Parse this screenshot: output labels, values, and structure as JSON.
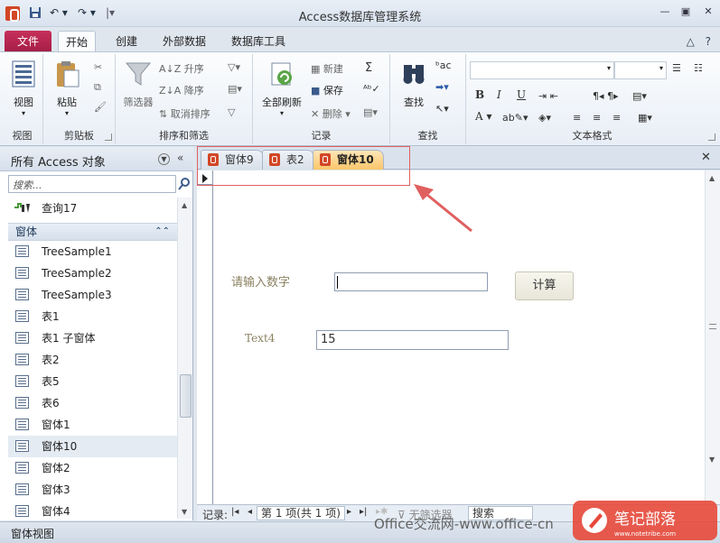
{
  "window": {
    "title": "Access数据库管理系统"
  },
  "ribbon_tabs": {
    "file": "文件",
    "items": [
      "开始",
      "创建",
      "外部数据",
      "数据库工具"
    ]
  },
  "ribbon": {
    "view": {
      "button": "视图",
      "group": "视图"
    },
    "clipboard": {
      "paste": "粘贴",
      "group": "剪贴板"
    },
    "sort_filter": {
      "filter": "筛选器",
      "ascending": "升序",
      "descending": "降序",
      "clear_sort": "取消排序",
      "group": "排序和筛选"
    },
    "records": {
      "refresh_all": "全部刷新",
      "new": "新建",
      "save": "保存",
      "delete": "删除",
      "group": "记录"
    },
    "find": {
      "find": "查找",
      "group": "查找"
    },
    "text_format": {
      "bold": "B",
      "italic": "I",
      "underline": "U",
      "font_color": "A",
      "group": "文本格式"
    }
  },
  "nav_pane": {
    "title": "所有 Access 对象",
    "search_placeholder": "搜索...",
    "top_item": "查询17",
    "group_label": "窗体",
    "items": [
      "TreeSample1",
      "TreeSample2",
      "TreeSample3",
      "表1",
      "表1 子窗体",
      "表2",
      "表5",
      "表6",
      "窗体1",
      "窗体10",
      "窗体2",
      "窗体3",
      "窗体4"
    ],
    "selected": "窗体10"
  },
  "document_tabs": [
    "窗体9",
    "表2",
    "窗体10"
  ],
  "form": {
    "prompt_label": "请输入数字",
    "input_value": "",
    "calc_button": "计算",
    "text4_label": "Text4",
    "text4_value": "15"
  },
  "record_nav": {
    "label": "记录:",
    "position": "第 1 项(共 1 项)",
    "filter": "无筛选器",
    "search": "搜索"
  },
  "status_bar": {
    "text": "窗体视图"
  },
  "watermarks": {
    "office": "Office交流网-www.office-cn",
    "brand": "笔记部落",
    "brand_url": "www.notetribe.com"
  },
  "colors": {
    "file_tab": "#b0234f",
    "active_doc_tab": "#fbc66a",
    "annotation": "#e06060",
    "brand": "#e7493a"
  }
}
